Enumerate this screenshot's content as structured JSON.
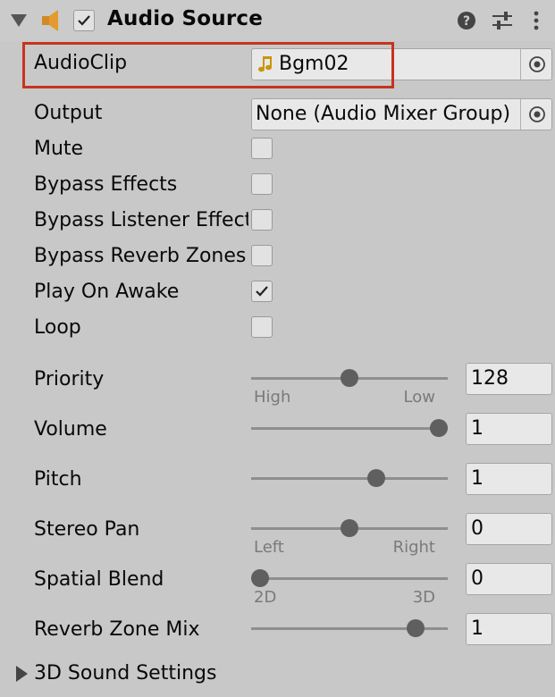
{
  "header": {
    "title": "Audio Source",
    "enabled": true,
    "icons": [
      "foldout-arrow-icon",
      "audio-source-icon",
      "help-icon",
      "preset-icon",
      "more-icon"
    ]
  },
  "fields": {
    "audioclip": {
      "label": "AudioClip",
      "value": "Bgm02",
      "icon": "audio-clip-icon"
    },
    "output": {
      "label": "Output",
      "value": "None (Audio Mixer Group)"
    },
    "mute": {
      "label": "Mute",
      "checked": false
    },
    "bypass_effects": {
      "label": "Bypass Effects",
      "checked": false
    },
    "bypass_listener": {
      "label": "Bypass Listener Effects",
      "checked": false
    },
    "bypass_reverb": {
      "label": "Bypass Reverb Zones",
      "checked": false
    },
    "play_on_awake": {
      "label": "Play On Awake",
      "checked": true
    },
    "loop": {
      "label": "Loop",
      "checked": false
    }
  },
  "sliders": {
    "priority": {
      "label": "Priority",
      "value": "128",
      "level": 0.5,
      "min_label": "High",
      "max_label": "Low"
    },
    "volume": {
      "label": "Volume",
      "value": "1",
      "level": 1.0
    },
    "pitch": {
      "label": "Pitch",
      "value": "1",
      "level": 0.65
    },
    "stereo_pan": {
      "label": "Stereo Pan",
      "value": "0",
      "level": 0.5,
      "min_label": "Left",
      "max_label": "Right"
    },
    "spatial_blend": {
      "label": "Spatial Blend",
      "value": "0",
      "level": 0.0,
      "min_label": "2D",
      "max_label": "3D"
    },
    "reverb_zone_mix": {
      "label": "Reverb Zone Mix",
      "value": "1",
      "level": 0.87
    }
  },
  "foldouts": {
    "sound_settings": {
      "label": "3D Sound Settings",
      "expanded": false
    }
  },
  "colors": {
    "background": "#c8c8c8",
    "highlight_border": "#c7331e",
    "clip_icon": "#c8960c"
  }
}
